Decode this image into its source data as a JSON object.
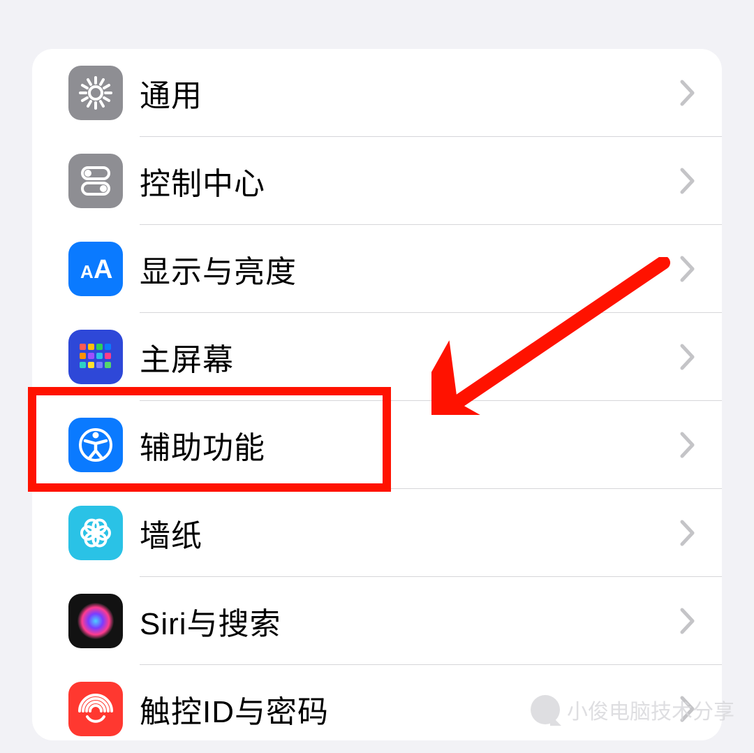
{
  "settings": {
    "items": [
      {
        "key": "general",
        "label": "通用",
        "icon_bg": "#8e8e93",
        "icon": "gear"
      },
      {
        "key": "control_center",
        "label": "控制中心",
        "icon_bg": "#8e8e93",
        "icon": "toggles"
      },
      {
        "key": "display",
        "label": "显示与亮度",
        "icon_bg": "#0a7aff",
        "icon": "text"
      },
      {
        "key": "home_screen",
        "label": "主屏幕",
        "icon_bg": "#2e48d8",
        "icon": "grid"
      },
      {
        "key": "accessibility",
        "label": "辅助功能",
        "icon_bg": "#0a7aff",
        "icon": "accessibility"
      },
      {
        "key": "wallpaper",
        "label": "墙纸",
        "icon_bg": "#2ac2e6",
        "icon": "flower"
      },
      {
        "key": "siri",
        "label": "Siri与搜索",
        "icon_bg": "#121212",
        "icon": "siri"
      },
      {
        "key": "touchid",
        "label": "触控ID与密码",
        "icon_bg": "#ff3830",
        "icon": "fingerprint"
      }
    ]
  },
  "annotation": {
    "highlight_index": 4,
    "colors": {
      "highlight": "#ff1200",
      "arrow": "#ff1200"
    }
  },
  "watermark": {
    "text": "小俊电脑技术分享"
  }
}
